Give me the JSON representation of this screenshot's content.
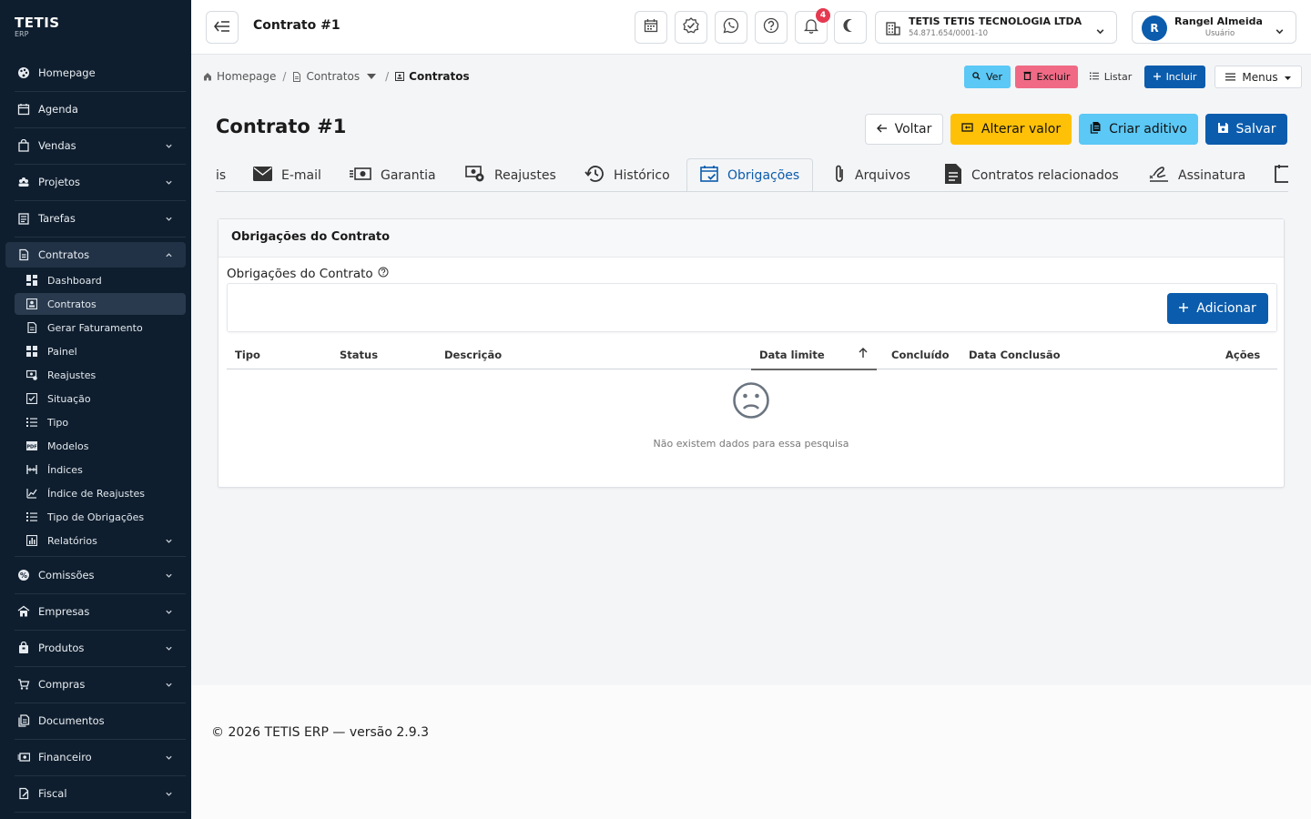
{
  "brand": {
    "name": "TETIS",
    "sub": "ERP"
  },
  "sidebar": {
    "items": [
      {
        "label": "Homepage",
        "icon": "palette-icon"
      },
      {
        "label": "Agenda",
        "icon": "calendar-icon"
      },
      {
        "label": "Vendas",
        "icon": "bag-icon"
      },
      {
        "label": "Projetos",
        "icon": "projects-icon"
      },
      {
        "label": "Tarefas",
        "icon": "tasks-icon"
      },
      {
        "label": "Contratos",
        "icon": "document-icon"
      },
      {
        "label": "Comissões",
        "icon": "badge-icon"
      },
      {
        "label": "Empresas",
        "icon": "building-icon"
      },
      {
        "label": "Produtos",
        "icon": "package-icon"
      },
      {
        "label": "Compras",
        "icon": "cart-icon"
      },
      {
        "label": "Documentos",
        "icon": "documents-icon"
      },
      {
        "label": "Financeiro",
        "icon": "money-icon"
      },
      {
        "label": "Fiscal",
        "icon": "fiscal-icon"
      }
    ],
    "contratos_sub": [
      {
        "label": "Dashboard"
      },
      {
        "label": "Contratos"
      },
      {
        "label": "Gerar Faturamento"
      },
      {
        "label": "Painel"
      },
      {
        "label": "Reajustes"
      },
      {
        "label": "Situação"
      },
      {
        "label": "Tipo"
      },
      {
        "label": "Modelos"
      },
      {
        "label": "Índices"
      },
      {
        "label": "Índice de Reajustes"
      },
      {
        "label": "Tipo de Obrigações"
      },
      {
        "label": "Relatórios"
      }
    ]
  },
  "header": {
    "title": "Contrato #1",
    "notifications": "4",
    "company": {
      "name": "TETIS TETIS TECNOLOGIA LTDA",
      "cnpj": "54.871.654/0001-10"
    },
    "user": {
      "initial": "R",
      "name": "Rangel Almeida",
      "role": "Usuário"
    }
  },
  "breadcrumb": {
    "home": "Homepage",
    "parent": "Contratos",
    "current": "Contratos"
  },
  "actions_small": {
    "ver": "Ver",
    "excluir": "Excluir",
    "listar": "Listar",
    "incluir": "Incluir",
    "menus": "Menus"
  },
  "page": {
    "title": "Contrato #1"
  },
  "actions": {
    "voltar": "Voltar",
    "alterar_valor": "Alterar valor",
    "criar_aditivo": "Criar aditivo",
    "salvar": "Salvar"
  },
  "tabs": [
    {
      "label": "is"
    },
    {
      "label": "E-mail"
    },
    {
      "label": "Garantia"
    },
    {
      "label": "Reajustes"
    },
    {
      "label": "Histórico"
    },
    {
      "label": "Obrigações"
    },
    {
      "label": "Arquivos"
    },
    {
      "label": "Contratos relacionados"
    },
    {
      "label": "Assinatura"
    }
  ],
  "card": {
    "title": "Obrigações do Contrato",
    "section_label": "Obrigações do Contrato",
    "add_label": "Adicionar",
    "columns": [
      "Tipo",
      "Status",
      "Descrição",
      "Data limite",
      "Concluído",
      "Data Conclusão",
      "Ações"
    ],
    "empty_message": "Não existem dados para essa pesquisa"
  },
  "footer": {
    "text": "© 2026 TETIS ERP — versão 2.9.3"
  },
  "colors": {
    "sidebar_bg": "#0f1e2e",
    "primary": "#0b5cad",
    "warning": "#ffc107",
    "info": "#5bc8f5",
    "danger": "#f06a85",
    "badge": "#e53950"
  }
}
